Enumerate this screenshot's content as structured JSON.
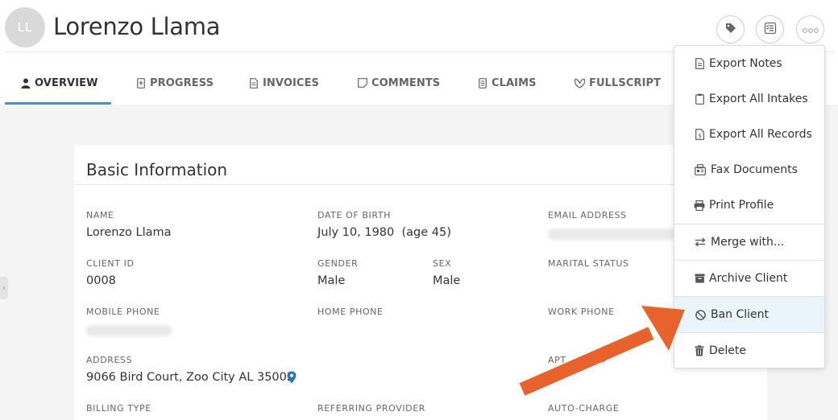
{
  "client": {
    "initials": "LL",
    "name": "Lorenzo Llama"
  },
  "header_actions": [
    {
      "name": "tag-icon"
    },
    {
      "name": "checklist-icon"
    },
    {
      "name": "more-options-icon"
    }
  ],
  "tabs": [
    {
      "label": "OVERVIEW",
      "icon": "person-icon",
      "active": true
    },
    {
      "label": "PROGRESS",
      "icon": "progress-doc-icon"
    },
    {
      "label": "INVOICES",
      "icon": "invoice-doc-icon"
    },
    {
      "label": "COMMENTS",
      "icon": "comment-icon"
    },
    {
      "label": "CLAIMS",
      "icon": "claims-doc-icon"
    },
    {
      "label": "FULLSCRIPT",
      "icon": "fullscript-leaf-icon"
    }
  ],
  "basic_info": {
    "title": "Basic Information",
    "name_label": "NAME",
    "name_value": "Lorenzo Llama",
    "dob_label": "DATE OF BIRTH",
    "dob_value": "July 10, 1980  (age 45)",
    "email_label": "EMAIL ADDRESS",
    "client_id_label": "CLIENT ID",
    "client_id_value": "0008",
    "gender_label": "GENDER",
    "gender_value": "Male",
    "sex_label": "SEX",
    "sex_value": "Male",
    "marital_label": "MARITAL STATUS",
    "mobile_label": "MOBILE PHONE",
    "home_phone_label": "HOME PHONE",
    "work_phone_label": "WORK PHONE",
    "address_label": "ADDRESS",
    "address_value": "9066 Bird Court, Zoo City AL 35002",
    "apt_label": "APT",
    "apt_hash": "#",
    "billing_label": "BILLING TYPE",
    "referring_label": "REFERRING PROVIDER",
    "autocharge_label": "AUTO-CHARGE"
  },
  "menu": {
    "items": [
      {
        "label": "Export Notes",
        "icon": "file-icon"
      },
      {
        "label": "Export All Intakes",
        "icon": "clipboard-icon"
      },
      {
        "label": "Export All Records",
        "icon": "file-dollar-icon"
      },
      {
        "label": "Fax Documents",
        "icon": "fax-icon"
      },
      {
        "label": "Print Profile",
        "icon": "printer-icon"
      },
      {
        "label": "Merge with...",
        "icon": "merge-arrows-icon"
      },
      {
        "label": "Archive Client",
        "icon": "archive-box-icon"
      },
      {
        "label": "Ban Client",
        "icon": "ban-icon",
        "highlighted": true
      },
      {
        "label": "Delete",
        "icon": "trash-icon"
      }
    ]
  },
  "colors": {
    "accent": "#4a90c9",
    "arrow": "#e8622c",
    "highlight": "#eaf5fb",
    "location_pin": "#2a7ab8"
  }
}
